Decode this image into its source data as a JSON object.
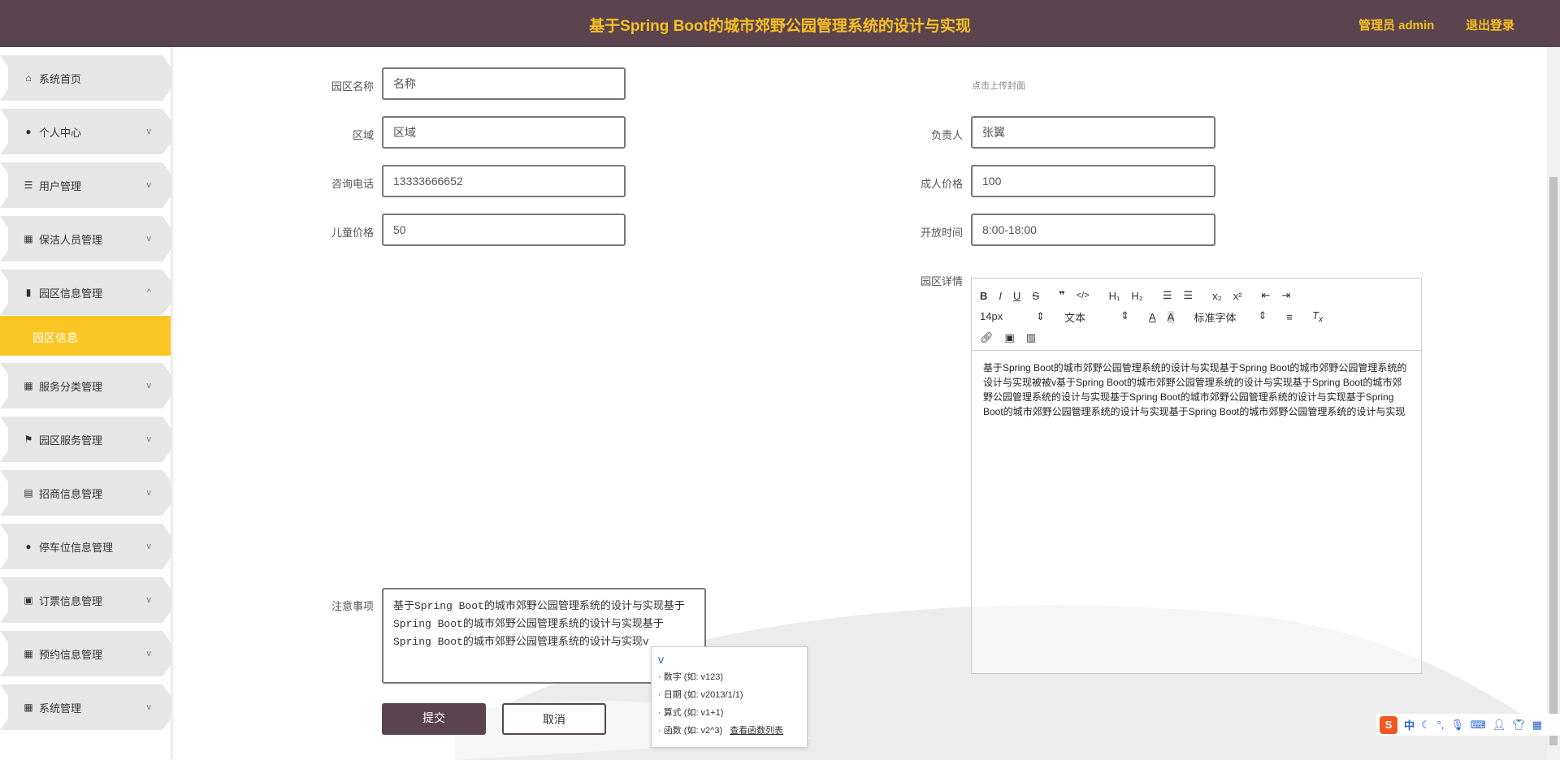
{
  "header": {
    "title": "基于Spring Boot的城市郊野公园管理系统的设计与实现",
    "user": "管理员 admin",
    "logout": "退出登录"
  },
  "sidebar": {
    "items": [
      {
        "label": "系统首页",
        "icon": "home-icon"
      },
      {
        "label": "个人中心",
        "icon": "user-icon"
      },
      {
        "label": "用户管理",
        "icon": "list-icon"
      },
      {
        "label": "保洁人员管理",
        "icon": "grid-icon"
      },
      {
        "label": "园区信息管理",
        "icon": "bar-chart-icon"
      },
      {
        "label": "服务分类管理",
        "icon": "grid-icon"
      },
      {
        "label": "园区服务管理",
        "icon": "flag-icon"
      },
      {
        "label": "招商信息管理",
        "icon": "clipboard-icon"
      },
      {
        "label": "停车位信息管理",
        "icon": "user-icon"
      },
      {
        "label": "订票信息管理",
        "icon": "ticket-icon"
      },
      {
        "label": "预约信息管理",
        "icon": "grid-icon"
      },
      {
        "label": "系统管理",
        "icon": "grid-icon"
      }
    ],
    "active_sub": "园区信息"
  },
  "form": {
    "name_label": "园区名称",
    "name_value": "名称",
    "area_label": "区域",
    "area_value": "区域",
    "phone_label": "咨询电话",
    "phone_value": "13333666652",
    "child_label": "儿童价格",
    "child_value": "50",
    "cover_hint": "点击上传封面",
    "manager_label": "负责人",
    "manager_value": "张翼",
    "adult_label": "成人价格",
    "adult_value": "100",
    "open_label": "开放时间",
    "open_value": "8:00-18:00",
    "detail_label": "园区详情",
    "notes_label": "注意事项",
    "notes_value": "基于Spring Boot的城市郊野公园管理系统的设计与实现基于Spring Boot的城市郊野公园管理系统的设计与实现基于Spring Boot的城市郊野公园管理系统的设计与实现v",
    "submit": "提交",
    "cancel": "取消"
  },
  "editor": {
    "size": "14px",
    "type": "文本",
    "font": "标准字体",
    "content": "基于Spring Boot的城市郊野公园管理系统的设计与实现基于Spring Boot的城市郊野公园管理系统的设计与实现被被v基于Spring Boot的城市郊野公园管理系统的设计与实现基于Spring Boot的城市郊野公园管理系统的设计与实现基于Spring Boot的城市郊野公园管理系统的设计与实现基于Spring Boot的城市郊野公园管理系统的设计与实现基于Spring Boot的城市郊野公园管理系统的设计与实现"
  },
  "ime_popup": {
    "input": "v",
    "items": [
      "· 数字 (如: v123)",
      "· 日期 (如: v2013/1/1)",
      "· 算式 (如: v1+1)",
      "· 函数 (如: v2^3)"
    ],
    "link": "查看函数列表"
  },
  "ime_bar": {
    "lang": "中"
  }
}
